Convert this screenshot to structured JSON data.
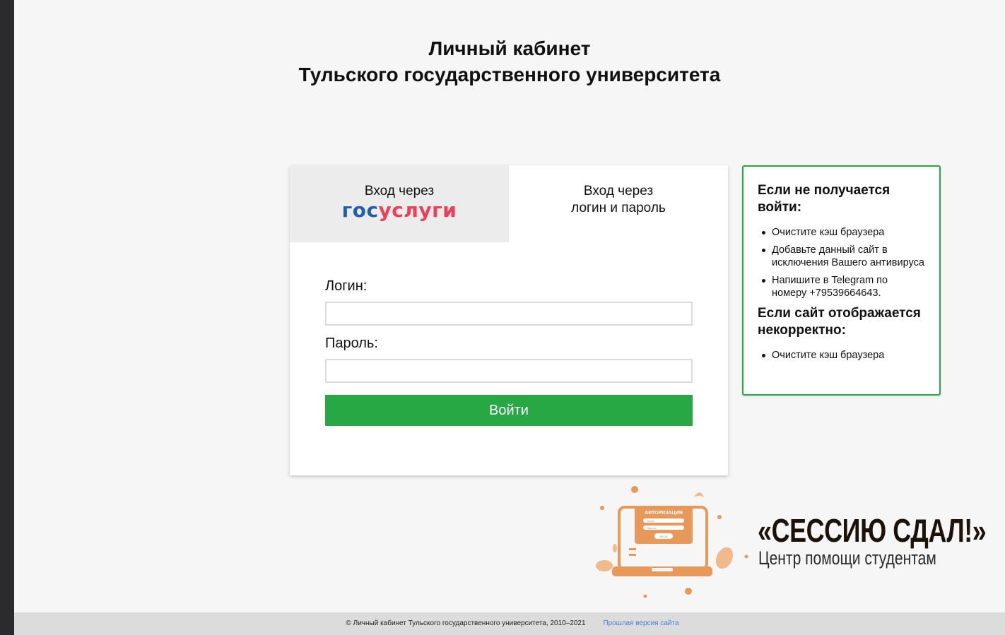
{
  "header": {
    "title_line1": "Личный кабинет",
    "title_line2": "Тульского государственного университета"
  },
  "tabs": {
    "gosuslugi": {
      "label": "Вход через",
      "logo_part1": "гос",
      "logo_part2": "услуги"
    },
    "login": {
      "label_line1": "Вход через",
      "label_line2": "логин и пароль"
    }
  },
  "form": {
    "login_label": "Логин:",
    "login_value": "",
    "password_label": "Пароль:",
    "password_value": "",
    "submit_label": "Войти"
  },
  "help": {
    "heading1": "Если не получается войти:",
    "items1": [
      "Очистите кэш браузера",
      "Добавьте данный сайт в исключения Вашего антивируса",
      "Напишите в Telegram по номеру +79539664643."
    ],
    "heading2": "Если сайт отображается некорректно:",
    "items2": [
      "Очистите кэш браузера"
    ]
  },
  "promo": {
    "title": "«СЕССИЮ СДАЛ!»",
    "subtitle": "Центр помощи студентам",
    "illus_header": "АВТОРИЗАЦИЯ",
    "illus_field1": "Логин",
    "illus_field2": "Пароль",
    "illus_button": "ВХОД"
  },
  "footer": {
    "copyright": "© Личный кабинет Тульского государственного университета, 2010–2021",
    "old_version_link": "Прошлая версия сайта"
  },
  "colors": {
    "accent_green": "#28a745",
    "gos_blue": "#1f5fae",
    "gos_red": "#ee3f58",
    "promo_orange": "#e8995a"
  }
}
